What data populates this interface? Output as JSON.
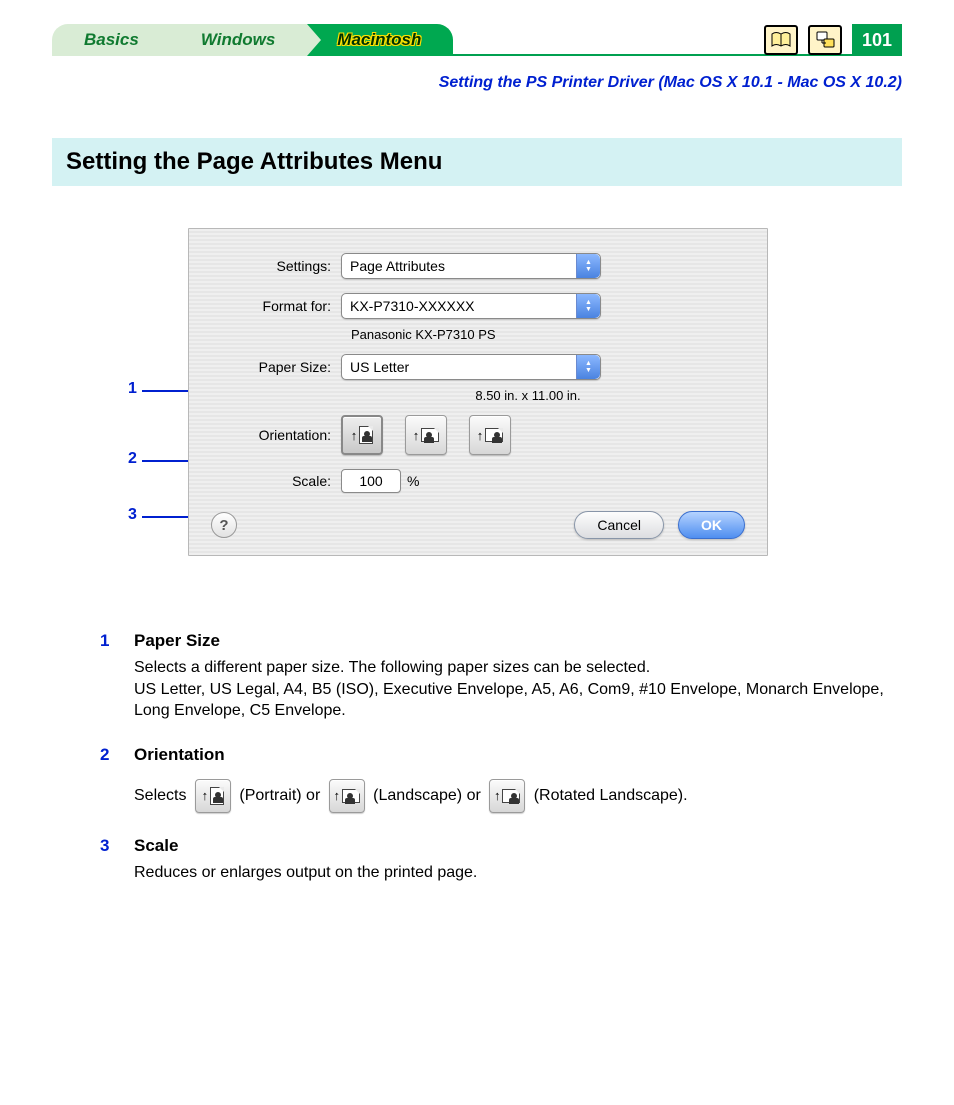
{
  "nav": {
    "tabs": {
      "basics": "Basics",
      "windows": "Windows",
      "macintosh": "Macintosh"
    },
    "page_number": "101"
  },
  "subtitle": "Setting the PS Printer Driver (Mac OS X 10.1 - Mac OS X 10.2)",
  "section_title": "Setting the Page Attributes Menu",
  "dialog": {
    "labels": {
      "settings": "Settings:",
      "format_for": "Format for:",
      "paper_size": "Paper Size:",
      "orientation": "Orientation:",
      "scale": "Scale:"
    },
    "values": {
      "settings": "Page Attributes",
      "format_for": "KX-P7310-XXXXXX",
      "printer_sub": "Panasonic KX-P7310 PS",
      "paper_size": "US Letter",
      "paper_dims": "8.50 in. x 11.00 in.",
      "scale": "100",
      "scale_unit": "%"
    },
    "buttons": {
      "cancel": "Cancel",
      "ok": "OK",
      "help": "?"
    }
  },
  "callouts": {
    "c1": "1",
    "c2": "2",
    "c3": "3"
  },
  "descriptions": {
    "d1": {
      "num": "1",
      "title": "Paper Size",
      "line1": "Selects a different paper size. The following paper sizes can be selected.",
      "line2": "US Letter,  US Legal, A4, B5 (ISO), Executive Envelope, A5, A6, Com9, #10 Envelope, Monarch Envelope, Long Envelope, C5 Envelope."
    },
    "d2": {
      "num": "2",
      "title": "Orientation",
      "pre": "Selects ",
      "p1": " (Portrait) or ",
      "p2": " (Landscape) or ",
      "p3": " (Rotated Landscape)."
    },
    "d3": {
      "num": "3",
      "title": "Scale",
      "line1": "Reduces or enlarges output on the printed page."
    }
  }
}
